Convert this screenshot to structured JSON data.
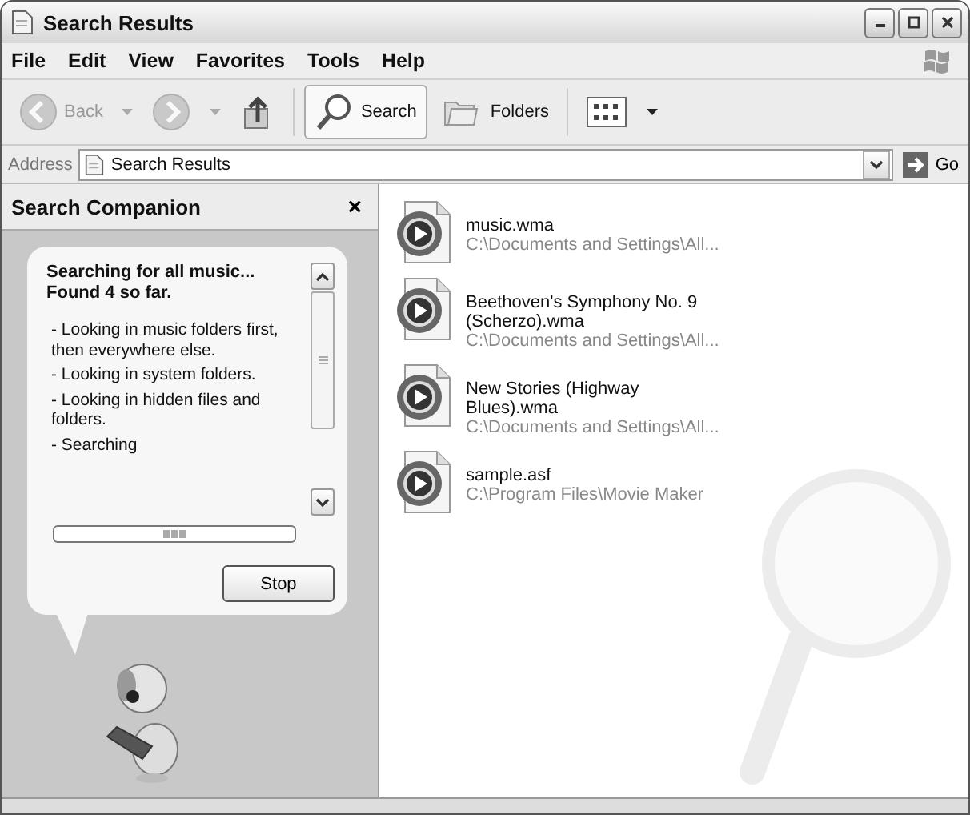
{
  "window": {
    "title": "Search Results"
  },
  "menu": [
    "File",
    "Edit",
    "View",
    "Favorites",
    "Tools",
    "Help"
  ],
  "toolbar": [
    {
      "kind": "back",
      "label": "Back",
      "disabled": true,
      "selected": false,
      "dropdown": true
    },
    {
      "kind": "forward",
      "disabled": true,
      "selected": false,
      "dropdown": true
    },
    {
      "kind": "up",
      "disabled": false,
      "selected": false,
      "dropdown": false
    },
    {
      "kind": "search",
      "label": "Search",
      "disabled": false,
      "selected": true,
      "dropdown": false
    },
    {
      "kind": "folders",
      "label": "Folders",
      "disabled": false,
      "selected": false,
      "dropdown": false
    },
    {
      "kind": "views",
      "disabled": false,
      "selected": false,
      "dropdown": true
    }
  ],
  "address": {
    "label": "Address",
    "value": "Search Results",
    "go": "Go"
  },
  "companion": {
    "title": "Search Companion",
    "close": "×",
    "heading": "Searching for all music... Found 4 so far.",
    "steps": [
      "- Looking in music folders first, then everywhere else.",
      "- Looking in system folders.",
      "- Looking in hidden files and folders.",
      "- Searching"
    ],
    "button": "Stop"
  },
  "results": [
    {
      "name": "music.wma",
      "path": "C:\\Documents and Settings\\All..."
    },
    {
      "name": "Beethoven's Symphony No. 9 (Scherzo).wma",
      "path": "C:\\Documents and Settings\\All..."
    },
    {
      "name": "New Stories (Highway Blues).wma",
      "path": "C:\\Documents and Settings\\All..."
    },
    {
      "name": "sample.asf",
      "path": "C:\\Program Files\\Movie Maker"
    }
  ]
}
